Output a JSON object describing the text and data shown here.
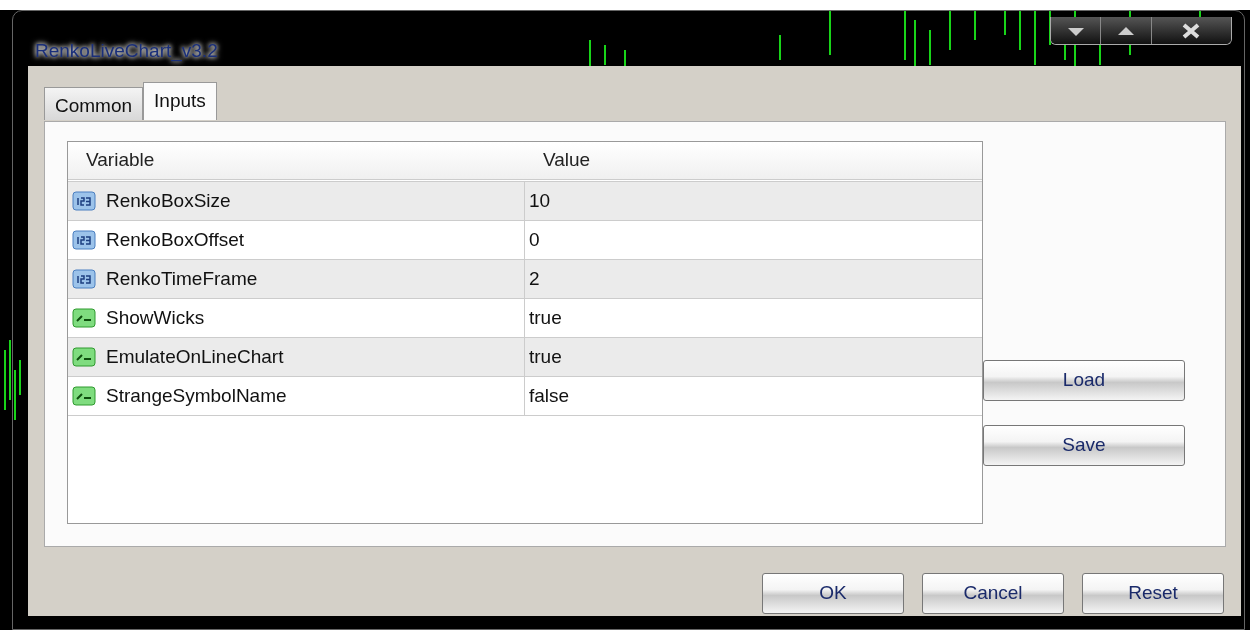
{
  "window": {
    "title": "RenkoLiveChart_v3.2"
  },
  "tabs": [
    {
      "label": "Common",
      "selected": false
    },
    {
      "label": "Inputs",
      "selected": true
    }
  ],
  "table": {
    "columns": [
      "Variable",
      "Value"
    ],
    "rows": [
      {
        "kind": "int",
        "variable": "RenkoBoxSize",
        "value": "10"
      },
      {
        "kind": "int",
        "variable": "RenkoBoxOffset",
        "value": "0"
      },
      {
        "kind": "int",
        "variable": "RenkoTimeFrame",
        "value": "2"
      },
      {
        "kind": "bool",
        "variable": "ShowWicks",
        "value": "true"
      },
      {
        "kind": "bool",
        "variable": "EmulateOnLineChart",
        "value": "true"
      },
      {
        "kind": "bool",
        "variable": "StrangeSymbolName",
        "value": "false"
      }
    ]
  },
  "side_buttons": [
    "Load",
    "Save"
  ],
  "buttons": [
    "OK",
    "Cancel",
    "Reset"
  ]
}
